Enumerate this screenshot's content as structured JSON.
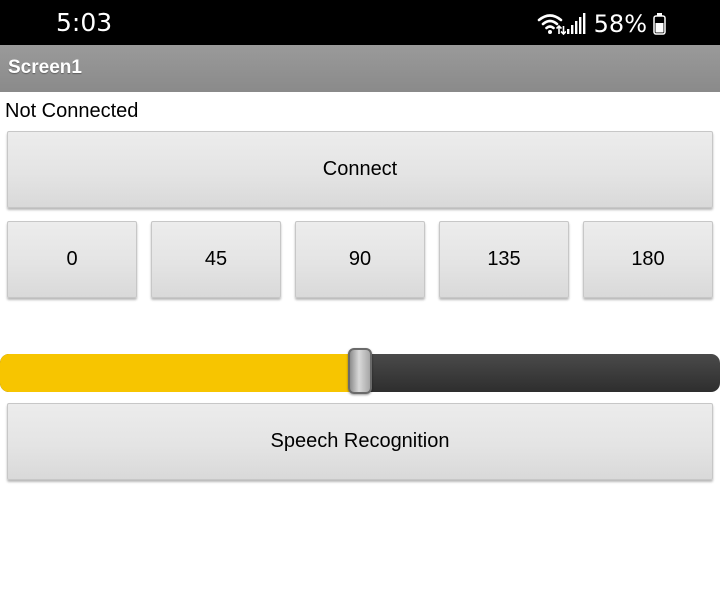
{
  "status_bar": {
    "time": "5:03",
    "battery_percent": "58%",
    "icons": [
      "wifi-icon",
      "signal-icon",
      "battery-icon"
    ]
  },
  "app_bar": {
    "title": "Screen1"
  },
  "connection_status": "Not Connected",
  "buttons": {
    "connect": "Connect",
    "angles": [
      "0",
      "45",
      "90",
      "135",
      "180"
    ],
    "speech": "Speech Recognition"
  },
  "slider": {
    "fraction": 0.5,
    "fill_color": "#f7c500",
    "track_color": "#3a3a3a"
  }
}
